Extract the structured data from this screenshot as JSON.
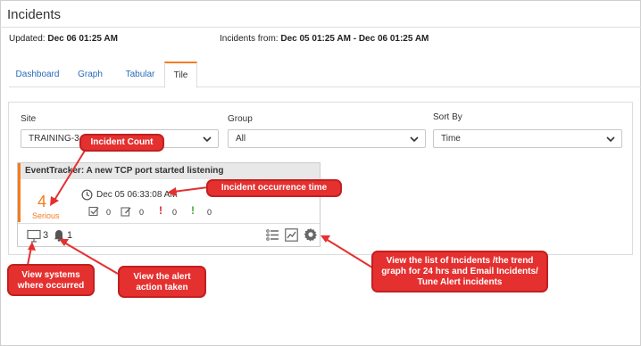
{
  "page": {
    "title": "Incidents"
  },
  "meta": {
    "updated_label": "Updated:",
    "updated_value": "Dec 06 01:25 AM",
    "range_label": "Incidents from:",
    "range_value": "Dec 05 01:25 AM - Dec 06 01:25 AM"
  },
  "tabs": [
    {
      "label": "Dashboard"
    },
    {
      "label": "Graph"
    },
    {
      "label": "Tabular"
    },
    {
      "label": "Tile",
      "active": true
    }
  ],
  "filters": {
    "site": {
      "label": "Site",
      "value": "TRAINING-3"
    },
    "group": {
      "label": "Group",
      "value": "All"
    },
    "sort": {
      "label": "Sort By",
      "value": "Time"
    }
  },
  "tile": {
    "title": "EventTracker: A new TCP port started listening",
    "count": "4",
    "severity": "Serious",
    "time": "Dec 05 06:33:08 AM",
    "stats": [
      "0",
      "0",
      "0",
      "0"
    ],
    "systems": "3",
    "alerts": "1"
  },
  "callouts": {
    "incident_count": "Incident Count",
    "occurrence_time": "Incident occurrence time",
    "systems": "View systems where occurred",
    "alert": "View the alert action taken",
    "list": "View the list of Incidents /the trend graph for 24 hrs and Email Incidents/ Tune Alert incidents"
  },
  "colors": {
    "accent": "#f47c20",
    "link": "#2a6ab8",
    "callout": "#e53030",
    "callout_text": "#ffffff"
  }
}
